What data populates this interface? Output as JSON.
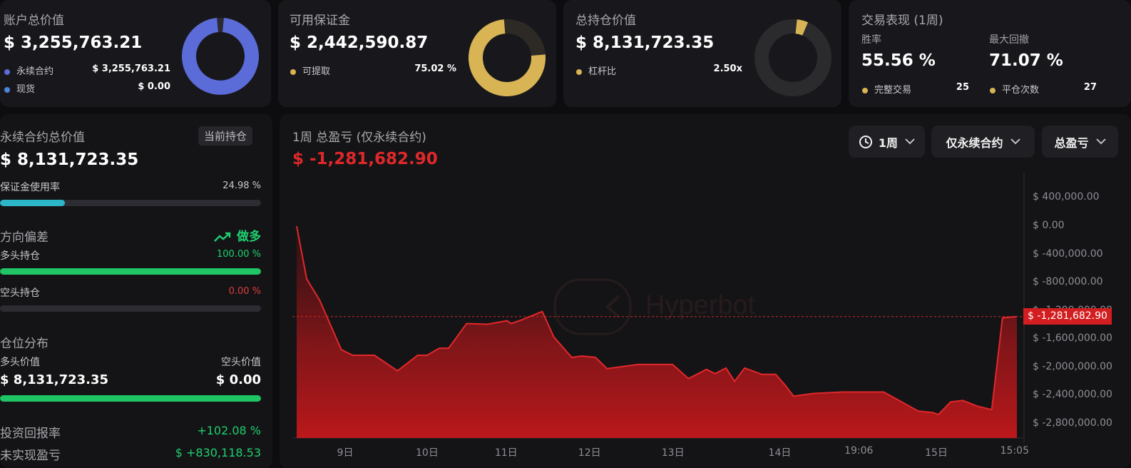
{
  "summary": {
    "account": {
      "title": "账户总价值",
      "value": "$ 3,255,763.21",
      "rows": [
        {
          "label": "永续合约",
          "value": "$ 3,255,763.21",
          "color": "#5b6bd8"
        },
        {
          "label": "现货",
          "value": "$ 0.00",
          "color": "#4a86d8"
        }
      ],
      "ring_fraction": 1.0,
      "ring_color": "#5b6bd8"
    },
    "margin": {
      "title": "可用保证金",
      "value": "$ 2,442,590.87",
      "rows": [
        {
          "label": "可提取",
          "value": "75.02 %",
          "color": "#d8b455"
        }
      ],
      "ring_fraction": 0.7502,
      "ring_color": "#d8b455"
    },
    "positions": {
      "title": "总持仓价值",
      "value": "$ 8,131,723.35",
      "rows": [
        {
          "label": "杠杆比",
          "value": "2.50x",
          "color": "#d8b455"
        }
      ],
      "ring_fraction": 0.05,
      "ring_color": "#d8b455"
    },
    "trading": {
      "title": "交易表现 (1周)",
      "win_rate_label": "胜率",
      "win_rate": "55.56 %",
      "max_dd_label": "最大回撤",
      "max_dd": "71.07 %",
      "completed_label": "完整交易",
      "completed": "25",
      "closes_label": "平仓次数",
      "closes": "27",
      "dot_color": "#d8b455"
    }
  },
  "left": {
    "perp_title": "永续合约总价值",
    "perp_badge": "当前持仓",
    "perp_value": "$ 8,131,723.35",
    "margin_usage_label": "保证金使用率",
    "margin_usage_value": "24.98 %",
    "margin_usage_fraction": 0.2498,
    "direction_title": "方向偏差",
    "direction_value": "做多",
    "long_label": "多头持仓",
    "long_value": "100.00 %",
    "long_fraction": 1.0,
    "short_label": "空头持仓",
    "short_value": "0.00 %",
    "short_fraction": 0.0,
    "dist_title": "仓位分布",
    "dist_long_label": "多头价值",
    "dist_short_label": "空头价值",
    "dist_long_value": "$ 8,131,723.35",
    "dist_short_value": "$ 0.00",
    "dist_long_fraction": 1.0,
    "roi_label": "投资回报率",
    "roi_value": "+102.08 %",
    "upnl_label": "未实现盈亏",
    "upnl_value": "$ +830,118.53"
  },
  "chart_panel": {
    "title": "1周 总盈亏 (仅永续合约)",
    "value": "$ -1,281,682.90",
    "period_label": "1周",
    "scope_label": "仅永续合约",
    "metric_label": "总盈亏",
    "watermark": "Hyperbot",
    "current_label": "$ -1,281,682.90"
  },
  "chart_data": {
    "type": "area",
    "title": "1周 总盈亏 (仅永续合约)",
    "y_ticks": [
      "$ 400,000.00",
      "$ 0.00",
      "$ -400,000.00",
      "$ -800,000.00",
      "$ -1,200,000.00",
      "$ -1,600,000.00",
      "$ -2,000,000.00",
      "$ -2,400,000.00",
      "$ -2,800,000.00"
    ],
    "y_tick_values": [
      400000,
      0,
      -400000,
      -800000,
      -1200000,
      -1600000,
      -2000000,
      -2400000,
      -2800000
    ],
    "x_ticks": [
      "9日",
      "10日",
      "11日",
      "12日",
      "13日",
      "14日",
      "19:06",
      "15日",
      "15:05"
    ],
    "x_tick_positions": [
      0.078,
      0.19,
      0.298,
      0.412,
      0.526,
      0.672,
      0.78,
      0.886,
      0.993
    ],
    "ylim": [
      -3000000,
      700000
    ],
    "current_value": -1281682.9,
    "x": [
      0.0,
      0.014,
      0.032,
      0.062,
      0.078,
      0.108,
      0.14,
      0.168,
      0.181,
      0.198,
      0.211,
      0.236,
      0.265,
      0.292,
      0.298,
      0.312,
      0.341,
      0.357,
      0.382,
      0.396,
      0.415,
      0.431,
      0.474,
      0.522,
      0.544,
      0.569,
      0.581,
      0.596,
      0.608,
      0.622,
      0.646,
      0.665,
      0.678,
      0.69,
      0.717,
      0.758,
      0.815,
      0.863,
      0.883,
      0.891,
      0.908,
      0.925,
      0.945,
      0.965,
      0.98,
      1.0
    ],
    "y": [
      0,
      -750000,
      -1050000,
      -1750000,
      -1830000,
      -1830000,
      -2050000,
      -1830000,
      -1830000,
      -1730000,
      -1730000,
      -1380000,
      -1390000,
      -1340000,
      -1380000,
      -1330000,
      -1210000,
      -1570000,
      -1860000,
      -1840000,
      -1860000,
      -2020000,
      -1960000,
      -1960000,
      -2160000,
      -2030000,
      -2090000,
      -2010000,
      -2200000,
      -2010000,
      -2100000,
      -2100000,
      -2250000,
      -2410000,
      -2370000,
      -2350000,
      -2350000,
      -2620000,
      -2640000,
      -2670000,
      -2490000,
      -2470000,
      -2550000,
      -2600000,
      -1300000,
      -1281682.9
    ]
  }
}
